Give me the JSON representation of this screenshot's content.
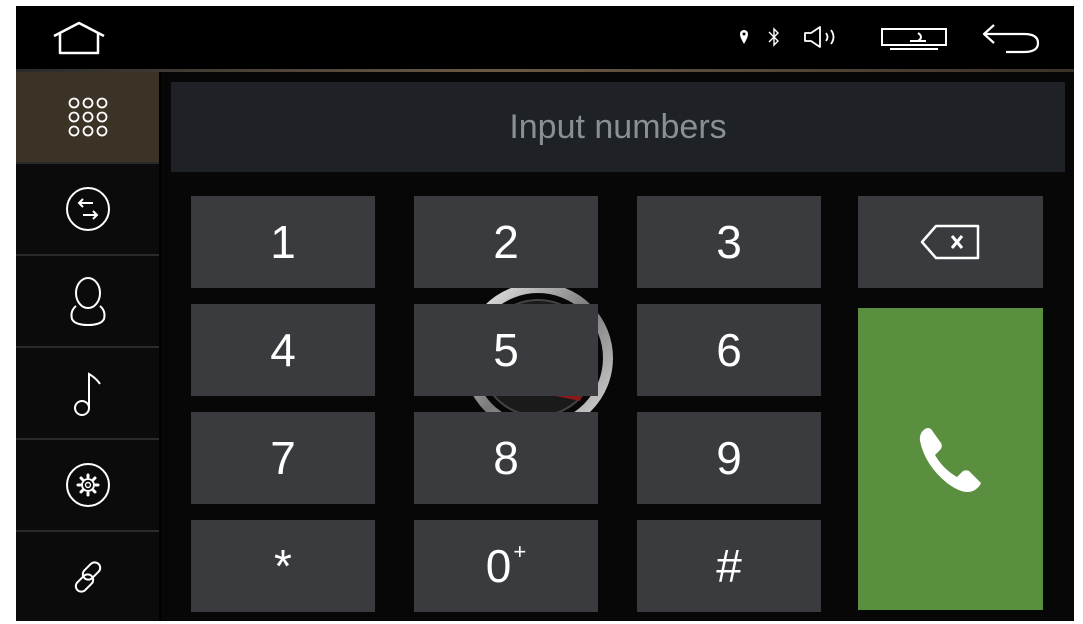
{
  "statusbar": {
    "icons": [
      "home-icon",
      "location-pin-icon",
      "bluetooth-icon",
      "volume-icon",
      "screen-mode-icon",
      "back-arrow-icon"
    ]
  },
  "sidebar": {
    "items": [
      {
        "name": "dialpad",
        "icon": "dialpad-grid-icon",
        "active": true
      },
      {
        "name": "call-log",
        "icon": "call-transfer-icon",
        "active": false
      },
      {
        "name": "contacts",
        "icon": "contact-person-icon",
        "active": false
      },
      {
        "name": "music",
        "icon": "music-note-icon",
        "active": false
      },
      {
        "name": "settings",
        "icon": "gear-icon",
        "active": false
      },
      {
        "name": "pairing",
        "icon": "link-icon",
        "active": false
      }
    ]
  },
  "dialer": {
    "placeholder": "Input numbers",
    "keys": [
      "1",
      "2",
      "3",
      "4",
      "5",
      "6",
      "7",
      "8",
      "9",
      "*",
      "0",
      "#"
    ],
    "zero_superscript": "+",
    "backspace_icon": "backspace-icon",
    "call_icon": "phone-call-icon"
  },
  "colors": {
    "call_button": "#5b8f40",
    "active_tab": "#3a3326",
    "key": "#393b3e",
    "display": "#1e2227"
  }
}
